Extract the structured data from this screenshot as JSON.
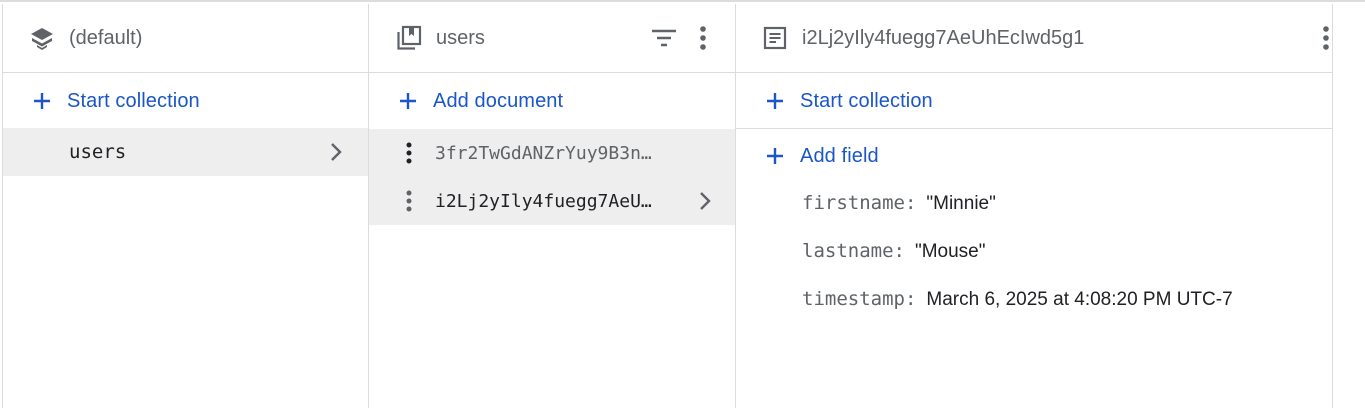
{
  "database_panel": {
    "title": "(default)",
    "start_collection_label": "Start collection",
    "collections": [
      {
        "name": "users"
      }
    ]
  },
  "collection_panel": {
    "title": "users",
    "add_document_label": "Add document",
    "documents": [
      {
        "id": "3fr2TwGdANZrYuy9B3n…"
      },
      {
        "id": "i2Lj2yIly4fuegg7AeU…"
      }
    ]
  },
  "document_panel": {
    "title": "i2Lj2yIly4fuegg7AeUhEcIwd5g1",
    "start_collection_label": "Start collection",
    "add_field_label": "Add field",
    "fields": [
      {
        "key": "firstname:",
        "value": "\"Minnie\""
      },
      {
        "key": "lastname:",
        "value": "\"Mouse\""
      },
      {
        "key": "timestamp:",
        "value": "March 6, 2025 at 4:08:20 PM UTC-7"
      }
    ]
  },
  "colors": {
    "accent": "#1a56c8",
    "border": "#dadce0",
    "selected": "#eeeeee",
    "muted": "#5f6368"
  },
  "icons": [
    "database-stack-icon",
    "collection-icon",
    "filter-icon",
    "more-vert-icon",
    "document-icon",
    "plus-icon",
    "chevron-right-icon"
  ]
}
